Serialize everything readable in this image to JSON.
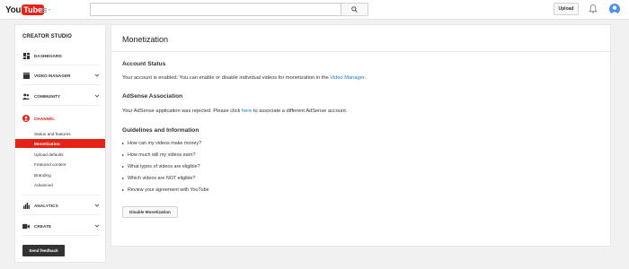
{
  "header": {
    "logo_you": "You",
    "logo_tube": "Tube",
    "search_placeholder": "",
    "upload_label": "Upload"
  },
  "sidebar": {
    "title": "CREATOR STUDIO",
    "nav": [
      {
        "label": "DASHBOARD",
        "icon": "dashboard-icon",
        "expandable": false
      },
      {
        "label": "VIDEO MANAGER",
        "icon": "video-manager-icon",
        "expandable": true
      },
      {
        "label": "COMMUNITY",
        "icon": "community-icon",
        "expandable": true
      },
      {
        "label": "CHANNEL",
        "icon": "channel-icon",
        "expandable": false,
        "active": true
      },
      {
        "label": "ANALYTICS",
        "icon": "analytics-icon",
        "expandable": true
      },
      {
        "label": "CREATE",
        "icon": "create-icon",
        "expandable": true
      }
    ],
    "channel_sub": [
      {
        "label": "Status and features"
      },
      {
        "label": "Monetization",
        "selected": true
      },
      {
        "label": "Upload defaults"
      },
      {
        "label": "Featured content"
      },
      {
        "label": "Branding"
      },
      {
        "label": "Advanced"
      }
    ],
    "feedback_label": "Send feedback"
  },
  "main": {
    "title": "Monetization",
    "account_status": {
      "heading": "Account Status",
      "text_before": "Your account is enabled. You can enable or disable individual videos for monetization in the ",
      "link": "Video Manager",
      "text_after": "."
    },
    "adsense": {
      "heading": "AdSense Association",
      "text_before": "Your AdSense application was rejected. Please click ",
      "link": "here",
      "text_after": " to associate a different AdSense account."
    },
    "guidelines": {
      "heading": "Guidelines and Information",
      "items": [
        "How can my videos make money?",
        "How much will my videos earn?",
        "What types of videos are eligible?",
        "Which videos are NOT eligible?",
        "Review your agreement with YouTube"
      ]
    },
    "disable_label": "Disable Monetization"
  },
  "colors": {
    "accent": "#e62117",
    "link": "#167ac6",
    "avatar": "#4d8fe9"
  }
}
